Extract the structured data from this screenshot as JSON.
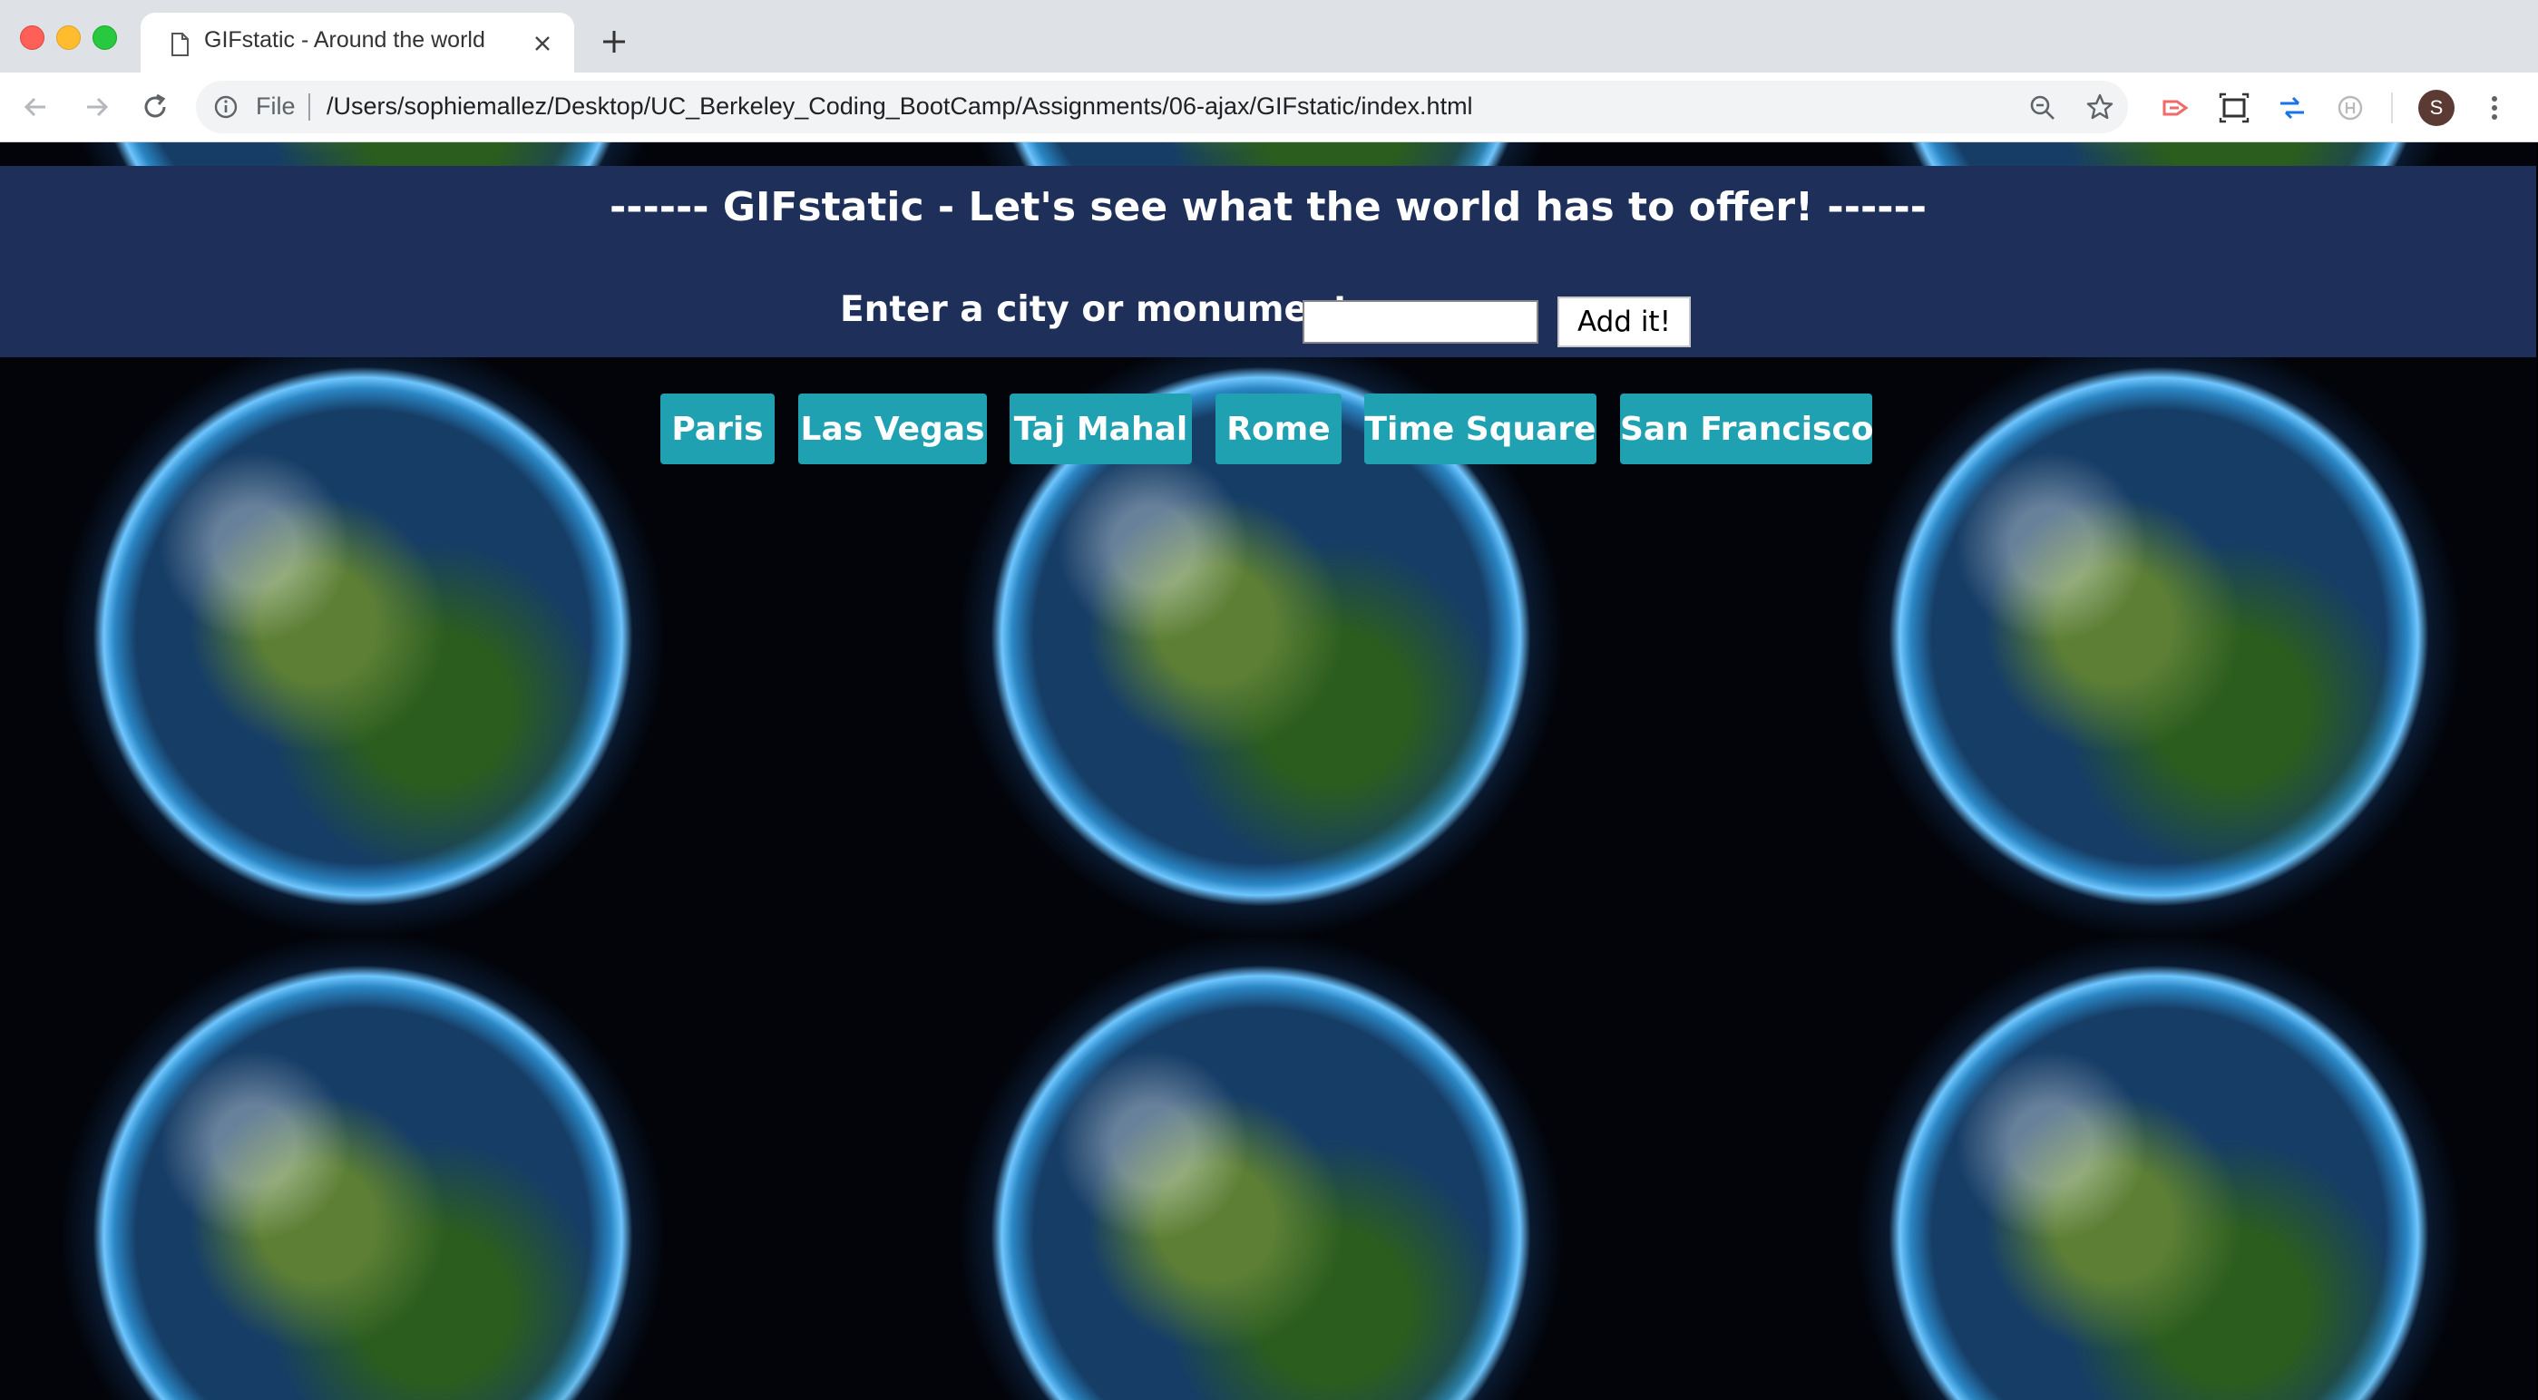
{
  "browser": {
    "tab_title": "GIFstatic - Around the world",
    "url_scheme": "File",
    "url": "/Users/sophiemallez/Desktop/UC_Berkeley_Coding_BootCamp/Assignments/06-ajax/GIFstatic/index.html",
    "avatar_letter": "S",
    "icons": [
      "document-icon",
      "close-icon",
      "new-tab-icon",
      "back-icon",
      "forward-icon",
      "reload-icon",
      "info-icon",
      "zoom-icon",
      "bookmark-star-icon",
      "extension-icons",
      "menu-icon"
    ]
  },
  "page": {
    "heading": "------ GIFstatic - Let's see what the world has to offer! ------",
    "city_label": "Enter a city or monument",
    "city_input_value": "",
    "add_button": "Add it!",
    "places": [
      "Paris",
      "Las Vegas",
      "Taj Mahal",
      "Rome",
      "Time Square",
      "San Francisco"
    ],
    "colors": {
      "header_band": "#1e305a",
      "place_button": "#1fa1b2",
      "background": "#000000"
    }
  }
}
